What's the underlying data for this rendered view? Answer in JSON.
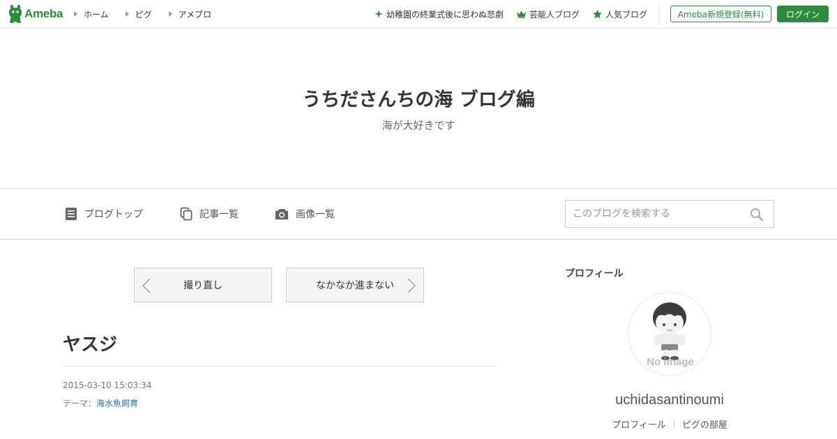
{
  "top_bar": {
    "logo_text": "Ameba",
    "nav": [
      {
        "label": "ホーム"
      },
      {
        "label": "ピグ"
      },
      {
        "label": "アメブロ"
      }
    ],
    "right_links": [
      {
        "label": "幼稚園の終業式後に思わぬ悲劇",
        "icon": "sparkle-icon"
      },
      {
        "label": "芸能人ブログ",
        "icon": "crown-icon"
      },
      {
        "label": "人気ブログ",
        "icon": "star-icon"
      }
    ],
    "register_label": "Ameba新規登録(無料)",
    "login_label": "ログイン",
    "accent_color": "#2d8c3c"
  },
  "header": {
    "blog_title": "うちださんちの海 ブログ編",
    "description": "海が大好きです"
  },
  "subnav": {
    "items": [
      {
        "label": "ブログトップ",
        "icon": "document-icon"
      },
      {
        "label": "記事一覧",
        "icon": "copy-icon"
      },
      {
        "label": "画像一覧",
        "icon": "camera-icon"
      }
    ],
    "search_placeholder": "このブログを検索する"
  },
  "pager": {
    "prev_label": "撮り直し",
    "next_label": "なかなか進まない"
  },
  "entry": {
    "title": "ヤスジ",
    "date": "2015-03-10 15:03:34",
    "theme_label": "テーマ：",
    "theme_value": "海水魚飼育"
  },
  "sidebar": {
    "heading": "プロフィール",
    "avatar_caption": "No image",
    "profile_name": "uchidasantinoumi",
    "links": [
      {
        "label": "プロフィール"
      },
      {
        "label": "ピグの部屋"
      }
    ]
  }
}
